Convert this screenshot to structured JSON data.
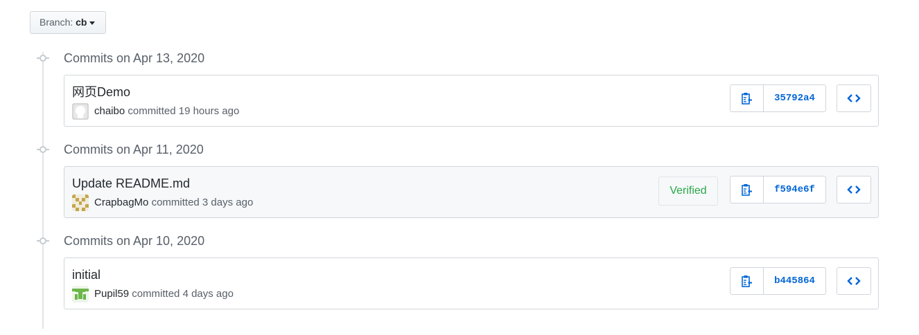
{
  "branch": {
    "label": "Branch:",
    "name": "cb"
  },
  "groups": [
    {
      "date_title": "Commits on Apr 13, 2020",
      "commit": {
        "message": "网页Demo",
        "author": "chaibo",
        "committed_text": "committed 19 hours ago",
        "sha": "35792a4",
        "verified": false
      }
    },
    {
      "date_title": "Commits on Apr 11, 2020",
      "commit": {
        "message": "Update README.md",
        "author": "CrapbagMo",
        "committed_text": "committed 3 days ago",
        "sha": "f594e6f",
        "verified": true,
        "verified_label": "Verified"
      }
    },
    {
      "date_title": "Commits on Apr 10, 2020",
      "commit": {
        "message": "initial",
        "author": "Pupil59",
        "committed_text": "committed 4 days ago",
        "sha": "b445864",
        "verified": false
      }
    }
  ],
  "colors": {
    "link": "#0366d6",
    "verified": "#28a745",
    "muted": "#586069",
    "border": "#d1d5da"
  },
  "icons": {
    "timeline": "git-commit-icon",
    "copy": "clippy-icon",
    "browse": "code-icon",
    "caret": "caret-down-icon"
  }
}
